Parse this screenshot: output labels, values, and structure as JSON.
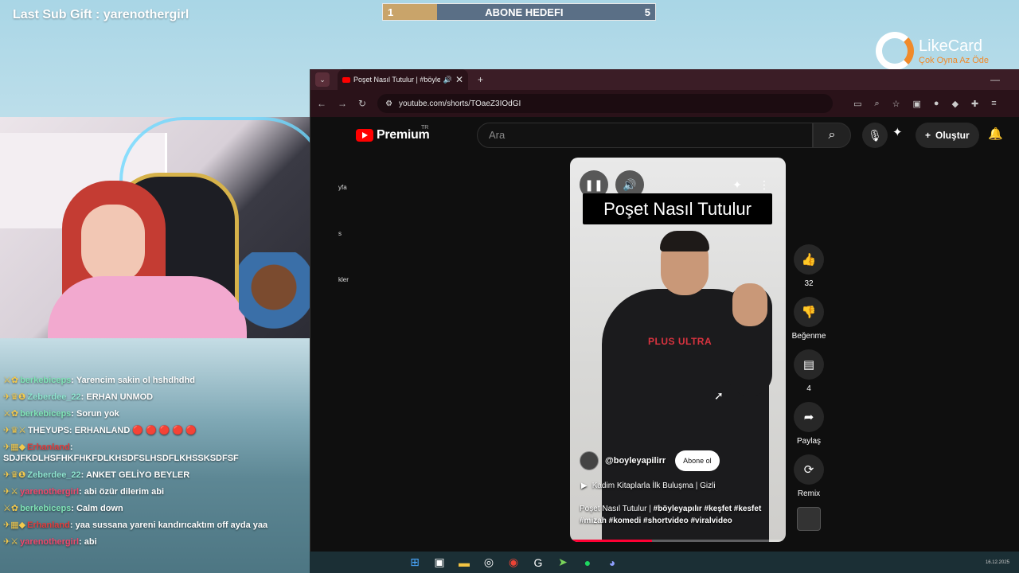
{
  "overlay": {
    "last_sub": "Last Sub Gift : yarenothergirl",
    "goal": {
      "current": "1",
      "title": "ABONE HEDEFI",
      "target": "5",
      "progress": 0.2
    },
    "sponsor": {
      "name": "LikeCard",
      "slogan": "Çok Oyna Az Öde"
    }
  },
  "chat": [
    {
      "user": "berkebiceps",
      "sep": ":",
      "text": "Yarencim sakin ol hshdhdhd",
      "color": "u-green",
      "badges": "⚔✿"
    },
    {
      "user": "Zeberdee_22",
      "sep": ":",
      "text": "ERHAN UNMOD",
      "color": "u-yellow",
      "badges": "✈♛❶"
    },
    {
      "user": "berkebiceps",
      "sep": ":",
      "text": "Sorun yok",
      "color": "u-green",
      "badges": "⚔✿"
    },
    {
      "user": "THEYUPS",
      "sep": ":",
      "text": "ERHANLAND 🔴 🔴 🔴 🔴 🔴",
      "color": "u-white",
      "badges": "✈♛⚔"
    },
    {
      "user": "Erhanland",
      "sep": ":",
      "text": "SDJFKDLHSFHKFHKFDLKHSDFSLHSDFLKHSSKSDFSF",
      "color": "u-red",
      "badges": "✈▦◆"
    },
    {
      "user": "Zeberdee_22",
      "sep": ":",
      "text": "ANKET GELİYO BEYLER",
      "color": "u-yellow",
      "badges": "✈♛❶"
    },
    {
      "user": "yarenothergirl",
      "sep": ":",
      "text": "abi özür dilerim abi",
      "color": "u-pink",
      "badges": "✈⚔"
    },
    {
      "user": "berkebiceps",
      "sep": ":",
      "text": "Calm down",
      "color": "u-green",
      "badges": "⚔✿"
    },
    {
      "user": "Erhanland",
      "sep": ":",
      "text": "yaa sussana yareni kandırıcaktım off ayda yaa",
      "color": "u-red",
      "badges": "✈▦◆"
    },
    {
      "user": "yarenothergirl",
      "sep": ":",
      "text": "abi",
      "color": "u-pink",
      "badges": "✈⚔"
    }
  ],
  "browser": {
    "tab_title": "Poşet Nasıl Tutulur | #böyleyapılır",
    "url": "youtube.com/shorts/TOaeZ3IOdGI"
  },
  "youtube": {
    "logo": "Premium",
    "region": "TR",
    "search_placeholder": "Ara",
    "create_label": "Oluştur",
    "side_fragments": [
      "yfa",
      "s",
      "kler"
    ]
  },
  "short": {
    "caption": "Poşet Nasıl Tutulur",
    "shirt_text": "PLUS ULTRA",
    "channel": "@boyleyapilirr",
    "subscribe_label": "Abone ol",
    "playlist": "Kadim Kitaplarla İlk Buluşma | Gizli",
    "desc_title": "Poşet Nasıl Tutulur | ",
    "desc_tags": "#böyleyapılır #keşfet #kesfet #mizah #komedi #shortvideo #viralvideo",
    "progress": 0.38,
    "likes": "32",
    "dislike_label": "Beğenme",
    "comments": "4",
    "share_label": "Paylaş",
    "remix_label": "Remix"
  },
  "taskbar": {
    "date": "16.12.2025"
  },
  "icons": {
    "windows": "windows-icon",
    "explorer": "file-explorer-icon",
    "chrome": "chrome-icon",
    "spotify": "spotify-icon",
    "discord": "discord-icon"
  },
  "colors": {
    "yt_red": "#ff0000",
    "goal_fill": "#c9a46a",
    "goal_bg": "#5a6f86",
    "likecard_orange": "#f08a2a"
  }
}
